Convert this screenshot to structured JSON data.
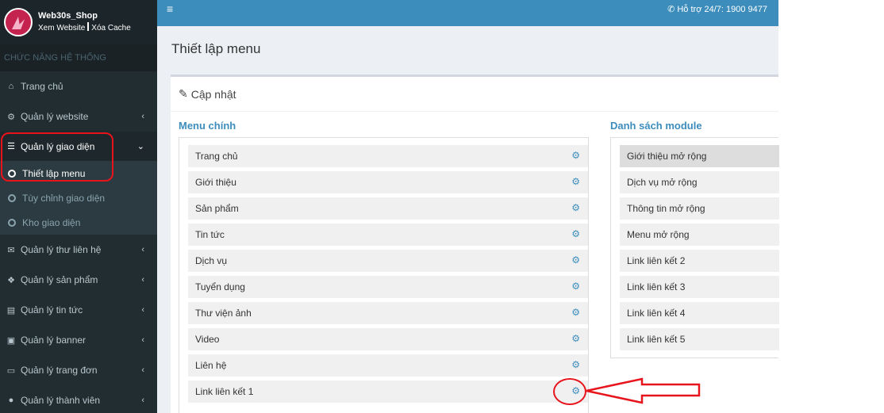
{
  "sidebar": {
    "shop_name": "Web30s_Shop",
    "view_site": "Xem Website",
    "clear_cache": "Xóa Cache",
    "section_title": "CHỨC NĂNG HỆ THỐNG",
    "items": [
      {
        "label": "Trang chủ",
        "icon": "home-icon"
      },
      {
        "label": "Quản lý website",
        "icon": "cogs-icon"
      },
      {
        "label": "Quản lý giao diện",
        "icon": "bars-icon"
      },
      {
        "label": "Quản lý thư liên hệ",
        "icon": "envelope-icon"
      },
      {
        "label": "Quản lý sản phẩm",
        "icon": "cubes-icon"
      },
      {
        "label": "Quản lý tin tức",
        "icon": "newspaper-icon"
      },
      {
        "label": "Quản lý banner",
        "icon": "image-icon"
      },
      {
        "label": "Quản lý trang đơn",
        "icon": "laptop-icon"
      },
      {
        "label": "Quản lý thành viên",
        "icon": "user-circle-icon"
      }
    ],
    "sub_items": [
      {
        "label": "Thiết lập menu"
      },
      {
        "label": "Tùy chỉnh giao diện"
      },
      {
        "label": "Kho giao diện"
      }
    ]
  },
  "topbar": {
    "support": "Hỗ trợ 24/7: 1900 9477"
  },
  "page": {
    "title": "Thiết lập menu",
    "box_title": "Cập nhật"
  },
  "main_menu": {
    "title": "Menu chính",
    "items": [
      "Trang chủ",
      "Giới thiệu",
      "Sản phẩm",
      "Tin tức",
      "Dịch vụ",
      "Tuyển dụng",
      "Thư viện ảnh",
      "Video",
      "Liên hệ",
      "Link liên kết 1"
    ]
  },
  "modules": {
    "title": "Danh sách module",
    "items": [
      "Giới thiệu mở rộng",
      "Dịch vụ mở rộng",
      "Thông tin mở rộng",
      "Menu mở rộng",
      "Link liên kết 2",
      "Link liên kết 3",
      "Link liên kết 4",
      "Link liên kết 5"
    ]
  },
  "colors": {
    "sidebar_bg": "#222d32",
    "topbar_bg": "#3c8dbc",
    "accent": "#3c8dbc",
    "annotation": "#e8141c"
  }
}
